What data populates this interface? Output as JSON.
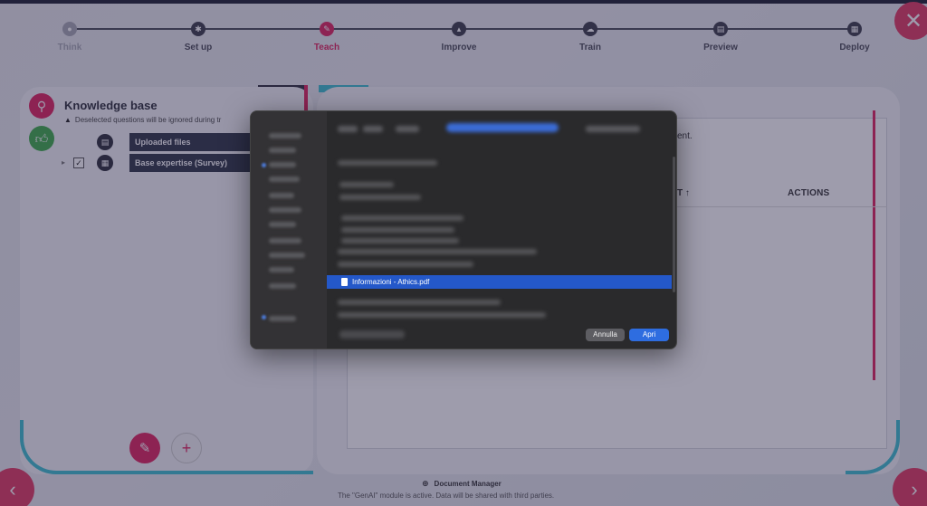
{
  "stepper": {
    "steps": [
      {
        "label": "Think",
        "icon": "lightbulb-icon",
        "state": "done"
      },
      {
        "label": "Set up",
        "icon": "gear-icon",
        "state": "pending"
      },
      {
        "label": "Teach",
        "icon": "pencil-icon",
        "state": "active"
      },
      {
        "label": "Improve",
        "icon": "upload-icon",
        "state": "pending"
      },
      {
        "label": "Train",
        "icon": "cloud-icon",
        "state": "pending"
      },
      {
        "label": "Preview",
        "icon": "monitor-icon",
        "state": "pending"
      },
      {
        "label": "Deploy",
        "icon": "grid-icon",
        "state": "pending"
      }
    ]
  },
  "knowledge_base": {
    "title": "Knowledge base",
    "warning": "Deselected questions will be ignored during tr",
    "items": [
      {
        "label": "Uploaded files",
        "icon": "document-icon"
      },
      {
        "label": "Base expertise (Survey)",
        "icon": "survey-icon",
        "checked": true
      }
    ]
  },
  "main": {
    "hint": "ent.",
    "sort_header": "T ↑",
    "actions_header": "ACTIONS"
  },
  "dialog": {
    "selected_file": "Informazioni - Athics.pdf",
    "cancel_label": "Annulla",
    "open_label": "Apri"
  },
  "footer": {
    "module_title": "Document Manager",
    "note": "The \"GenAI\" module is active. Data will be shared with third parties."
  },
  "colors": {
    "accent": "#e0245e",
    "teal": "#3cbfd0",
    "green": "#3fae49",
    "dialog_select": "#2458c9",
    "dialog_primary": "#2e6de0"
  }
}
